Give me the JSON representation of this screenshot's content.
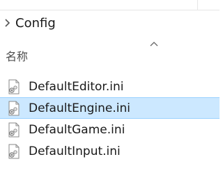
{
  "breadcrumb": {
    "current": "Config"
  },
  "header": {
    "name_column": "名称"
  },
  "files": [
    {
      "name": "DefaultEditor.ini",
      "selected": false
    },
    {
      "name": "DefaultEngine.ini",
      "selected": true
    },
    {
      "name": "DefaultGame.ini",
      "selected": false
    },
    {
      "name": "DefaultInput.ini",
      "selected": false
    }
  ],
  "colors": {
    "selection_fill": "#cce8ff",
    "selection_border": "#99d1ff"
  },
  "icons": {
    "breadcrumb_chevron": "chevron-right-icon",
    "sort_indicator": "chevron-up-icon",
    "file": "ini-settings-file-icon"
  }
}
